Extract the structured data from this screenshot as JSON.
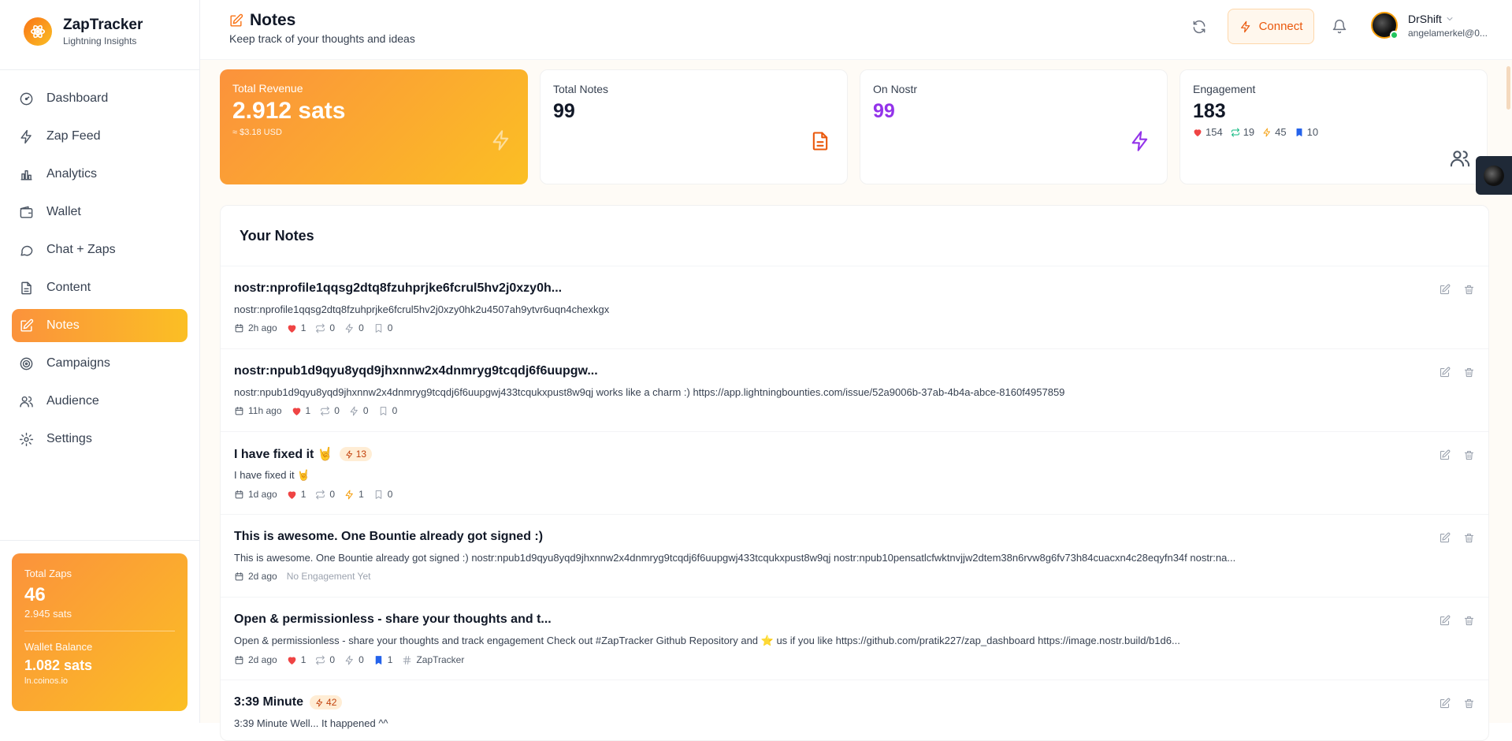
{
  "app": {
    "name": "ZapTracker",
    "tagline": "Lightning Insights"
  },
  "sidebar": {
    "items": [
      {
        "label": "Dashboard",
        "icon": "gauge-icon"
      },
      {
        "label": "Zap Feed",
        "icon": "lightning-icon"
      },
      {
        "label": "Analytics",
        "icon": "bar-chart-icon"
      },
      {
        "label": "Wallet",
        "icon": "wallet-icon"
      },
      {
        "label": "Chat + Zaps",
        "icon": "chat-icon"
      },
      {
        "label": "Content",
        "icon": "document-icon"
      },
      {
        "label": "Notes",
        "icon": "edit-icon",
        "active": true
      },
      {
        "label": "Campaigns",
        "icon": "target-icon"
      },
      {
        "label": "Audience",
        "icon": "users-icon"
      },
      {
        "label": "Settings",
        "icon": "gear-icon"
      }
    ],
    "summary": {
      "zaps_label": "Total Zaps",
      "zaps_value": "46",
      "zaps_sats": "2.945 sats",
      "balance_label": "Wallet Balance",
      "balance_value": "1.082 sats",
      "wallet_provider": "ln.coinos.io"
    }
  },
  "header": {
    "title": "Notes",
    "subtitle": "Keep track of your thoughts and ideas",
    "connect_label": "Connect",
    "user_name": "DrShift",
    "user_email": "angelamerkel@0..."
  },
  "stats": {
    "revenue_label": "Total Revenue",
    "revenue_value": "2.912 sats",
    "revenue_usd": "≈ $3.18 USD",
    "notes_label": "Total Notes",
    "notes_value": "99",
    "nostr_label": "On Nostr",
    "nostr_value": "99",
    "engagement_label": "Engagement",
    "engagement_value": "183",
    "likes": "154",
    "reposts": "19",
    "zaps": "45",
    "bookmarks": "10"
  },
  "notes_section": {
    "title": "Your Notes"
  },
  "notes": [
    {
      "title": "nostr:nprofile1qqsg2dtq8fzuhprjke6fcrul5hv2j0xzy0h...",
      "body": "nostr:nprofile1qqsg2dtq8fzuhprjke6fcrul5hv2j0xzy0hk2u4507ah9ytvr6uqn4chexkgx",
      "time": "2h ago",
      "likes": "1",
      "reposts": "0",
      "zaps": "0",
      "bookmarks": "0"
    },
    {
      "title": "nostr:npub1d9qyu8yqd9jhxnnw2x4dnmryg9tcqdj6f6uupgw...",
      "body": "nostr:npub1d9qyu8yqd9jhxnnw2x4dnmryg9tcqdj6f6uupgwj433tcqukxpust8w9qj works like a charm :) https://app.lightningbounties.com/issue/52a9006b-37ab-4b4a-abce-8160f4957859",
      "time": "11h ago",
      "likes": "1",
      "reposts": "0",
      "zaps": "0",
      "bookmarks": "0"
    },
    {
      "title": "I have fixed it 🤘",
      "badge": "13",
      "body": "I have fixed it 🤘",
      "time": "1d ago",
      "likes": "1",
      "reposts": "0",
      "zaps": "1",
      "bookmarks": "0"
    },
    {
      "title": "This is awesome. One Bountie already got signed :)",
      "body": "This is awesome. One Bountie already got signed :) nostr:npub1d9qyu8yqd9jhxnnw2x4dnmryg9tcqdj6f6uupgwj433tcqukxpust8w9qj nostr:npub10pensatlcfwktnvjjw2dtem38n6rvw8g6fv73h84cuacxn4c28eqyfn34f nostr:na...",
      "time": "2d ago",
      "no_engagement": "No Engagement Yet"
    },
    {
      "title": "Open & permissionless - share your thoughts and t...",
      "body": "Open & permissionless - share your thoughts and track engagement Check out #ZapTracker Github Repository and ⭐ us if you like https://github.com/pratik227/zap_dashboard https://image.nostr.build/b1d6...",
      "time": "2d ago",
      "likes": "1",
      "reposts": "0",
      "zaps": "0",
      "bookmarks": "1",
      "tag": "ZapTracker"
    },
    {
      "title": "3:39 Minute",
      "badge": "42",
      "body": "3:39 Minute Well... It happened ^^",
      "time": ""
    }
  ],
  "colors": {
    "accent": "#f97316",
    "accent_light": "#fbbf24",
    "purple": "#9333ea",
    "like": "#ef4444",
    "repost": "#10b981",
    "zap": "#f59e0b",
    "bookmark": "#2563eb"
  }
}
